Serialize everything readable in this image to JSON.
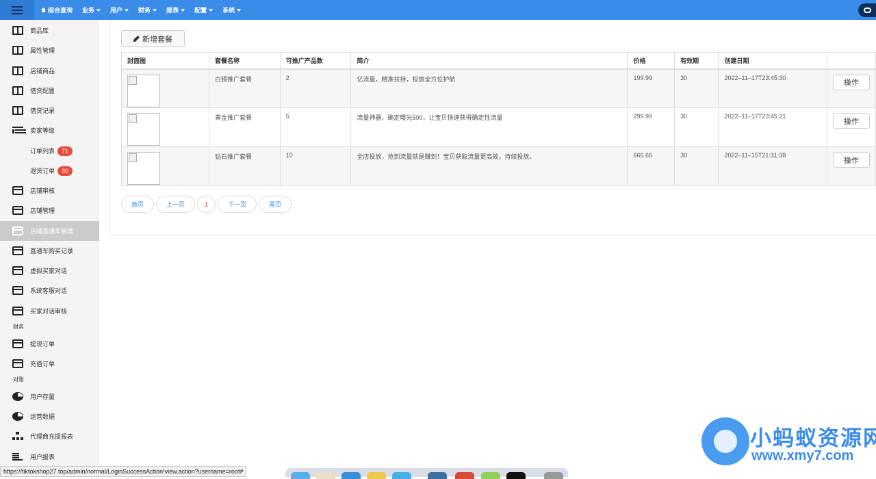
{
  "topbar": {
    "nav": [
      {
        "label": "综合查询",
        "caret": false,
        "icon": "home-icon"
      },
      {
        "label": "业务",
        "caret": true
      },
      {
        "label": "用户",
        "caret": true
      },
      {
        "label": "财务",
        "caret": true
      },
      {
        "label": "报表",
        "caret": true
      },
      {
        "label": "配置",
        "caret": true
      },
      {
        "label": "系统",
        "caret": true
      }
    ]
  },
  "sidebar": {
    "items": [
      {
        "label": "商品库",
        "icon": "book-icon"
      },
      {
        "label": "属性管理",
        "icon": "book-icon"
      },
      {
        "label": "店铺商品",
        "icon": "book-icon"
      },
      {
        "label": "借贷配置",
        "icon": "book-icon"
      },
      {
        "label": "借贷记录",
        "icon": "book-icon"
      },
      {
        "label": "卖家等级",
        "icon": "list-icon"
      },
      {
        "label": "订单列表",
        "badge": "71"
      },
      {
        "label": "退货订单",
        "badge": "30"
      },
      {
        "label": "店铺审核",
        "icon": "card-icon"
      },
      {
        "label": "店铺管理",
        "icon": "card-icon"
      },
      {
        "label": "店铺直通车管理",
        "icon": "card-icon",
        "active": true
      },
      {
        "label": "直通车购买记录",
        "icon": "card-icon"
      },
      {
        "label": "虚拟买家对话",
        "icon": "card-icon"
      },
      {
        "label": "系统客服对话",
        "icon": "card-icon"
      },
      {
        "label": "买家对话审核",
        "icon": "card-icon"
      },
      {
        "label": "提现订单",
        "icon": "card-icon"
      },
      {
        "label": "充值订单",
        "icon": "card-icon"
      },
      {
        "label": "用户存量",
        "icon": "pie-icon"
      },
      {
        "label": "运营数据",
        "icon": "pie-icon"
      },
      {
        "label": "代理商充提报表",
        "icon": "sitemap-icon"
      },
      {
        "label": "用户报表",
        "icon": "bars-icon"
      }
    ],
    "section_finance": "财务",
    "section_reconcile": "对账"
  },
  "main": {
    "add_button": "新增套餐",
    "table": {
      "headers": [
        "封面图",
        "套餐名称",
        "可推广产品数",
        "简介",
        "价格",
        "有效期",
        "创建日期",
        ""
      ],
      "rows": [
        {
          "name": "白银推广套餐",
          "count": "2",
          "intro": "亿流量，精准扶持，投放全方位护航",
          "price": "199.99",
          "days": "30",
          "created": "2022–11–17T23:45:30",
          "action": "操作"
        },
        {
          "name": "黄金推广套餐",
          "count": "5",
          "intro": "流量神器，确定曝光500，让宝贝快速获得确定性流量",
          "price": "299.99",
          "days": "30",
          "created": "2022–11–17T23:45:21",
          "action": "操作"
        },
        {
          "name": "钻石推广套餐",
          "count": "10",
          "intro": "全店投放，抢到流量就是赚到！宝贝获取流量更高效，持续投放。",
          "price": "666.66",
          "days": "30",
          "created": "2022–11–15T21:31:38",
          "action": "操作"
        }
      ]
    },
    "pager": {
      "first": "首页",
      "prev": "上一页",
      "current": "1",
      "next": "下一页",
      "last": "尾页"
    }
  },
  "status_url": "https://tiktokshop27.top/admin/normal/LoginSuccessAction!view.action?username=root#",
  "watermark": {
    "title": "小蚂蚁资源网",
    "url": "www.xmy7.com"
  },
  "colors": {
    "topbar": "#3b8be9",
    "badge": "#e74c3c",
    "link": "#3b8be9"
  }
}
